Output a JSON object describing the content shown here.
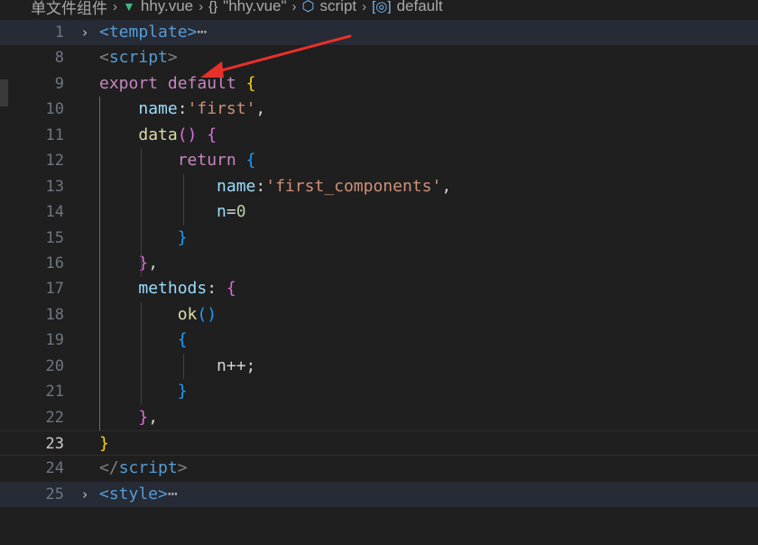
{
  "breadcrumb": {
    "folder": "单文件组件",
    "file": "hhy.vue",
    "object_path": "\"hhy.vue\"",
    "section": "script",
    "symbol": "default"
  },
  "lines": [
    {
      "n": "1",
      "fold": "›",
      "tokens": [
        [
          "tag",
          "<template>"
        ],
        [
          "ellipsis",
          "⋯"
        ]
      ]
    },
    {
      "n": "8",
      "fold": "",
      "tokens": [
        [
          "punct",
          "<"
        ],
        [
          "tag",
          "script"
        ],
        [
          "punct",
          ">"
        ]
      ]
    },
    {
      "n": "9",
      "fold": "",
      "tokens": [
        [
          "kw-ctrl",
          "export"
        ],
        [
          "plain",
          " "
        ],
        [
          "kw-ctrl",
          "default"
        ],
        [
          "plain",
          " "
        ],
        [
          "br1",
          "{"
        ]
      ]
    },
    {
      "n": "10",
      "fold": "",
      "tokens": [
        [
          "plain",
          "    "
        ],
        [
          "prop",
          "name"
        ],
        [
          "plain",
          ":"
        ],
        [
          "str",
          "'first'"
        ],
        [
          "plain",
          ","
        ]
      ]
    },
    {
      "n": "11",
      "fold": "",
      "tokens": [
        [
          "plain",
          "    "
        ],
        [
          "fn",
          "data"
        ],
        [
          "br2",
          "()"
        ],
        [
          "plain",
          " "
        ],
        [
          "br2",
          "{"
        ]
      ]
    },
    {
      "n": "12",
      "fold": "",
      "tokens": [
        [
          "plain",
          "        "
        ],
        [
          "kw-ctrl",
          "return"
        ],
        [
          "plain",
          " "
        ],
        [
          "br3",
          "{"
        ]
      ]
    },
    {
      "n": "13",
      "fold": "",
      "tokens": [
        [
          "plain",
          "            "
        ],
        [
          "prop",
          "name"
        ],
        [
          "plain",
          ":"
        ],
        [
          "str",
          "'first_components'"
        ],
        [
          "plain",
          ","
        ]
      ]
    },
    {
      "n": "14",
      "fold": "",
      "tokens": [
        [
          "plain",
          "            "
        ],
        [
          "prop",
          "n"
        ],
        [
          "plain",
          "="
        ],
        [
          "num",
          "0"
        ]
      ]
    },
    {
      "n": "15",
      "fold": "",
      "tokens": [
        [
          "plain",
          "        "
        ],
        [
          "br3",
          "}"
        ]
      ]
    },
    {
      "n": "16",
      "fold": "",
      "tokens": [
        [
          "plain",
          "    "
        ],
        [
          "br2",
          "}"
        ],
        [
          "plain",
          ","
        ]
      ]
    },
    {
      "n": "17",
      "fold": "",
      "tokens": [
        [
          "plain",
          "    "
        ],
        [
          "prop",
          "methods"
        ],
        [
          "plain",
          ": "
        ],
        [
          "br2",
          "{"
        ]
      ]
    },
    {
      "n": "18",
      "fold": "",
      "tokens": [
        [
          "plain",
          "        "
        ],
        [
          "fn",
          "ok"
        ],
        [
          "br3",
          "()"
        ]
      ]
    },
    {
      "n": "19",
      "fold": "",
      "tokens": [
        [
          "plain",
          "        "
        ],
        [
          "br3",
          "{"
        ]
      ]
    },
    {
      "n": "20",
      "fold": "",
      "tokens": [
        [
          "plain",
          "            "
        ],
        [
          "plain",
          "n++;"
        ]
      ]
    },
    {
      "n": "21",
      "fold": "",
      "tokens": [
        [
          "plain",
          "        "
        ],
        [
          "br3",
          "}"
        ]
      ]
    },
    {
      "n": "22",
      "fold": "",
      "tokens": [
        [
          "plain",
          "    "
        ],
        [
          "br2",
          "}"
        ],
        [
          "plain",
          ","
        ]
      ]
    },
    {
      "n": "23",
      "fold": "",
      "tokens": [
        [
          "br1",
          "}"
        ]
      ]
    },
    {
      "n": "24",
      "fold": "",
      "tokens": [
        [
          "punct",
          "</"
        ],
        [
          "tag",
          "script"
        ],
        [
          "punct",
          ">"
        ]
      ]
    },
    {
      "n": "25",
      "fold": "›",
      "tokens": [
        [
          "tag",
          "<style>"
        ],
        [
          "ellipsis",
          "⋯"
        ]
      ]
    }
  ],
  "colors": {
    "background": "#1f1f1f",
    "annotation_arrow": "#e8302a"
  }
}
